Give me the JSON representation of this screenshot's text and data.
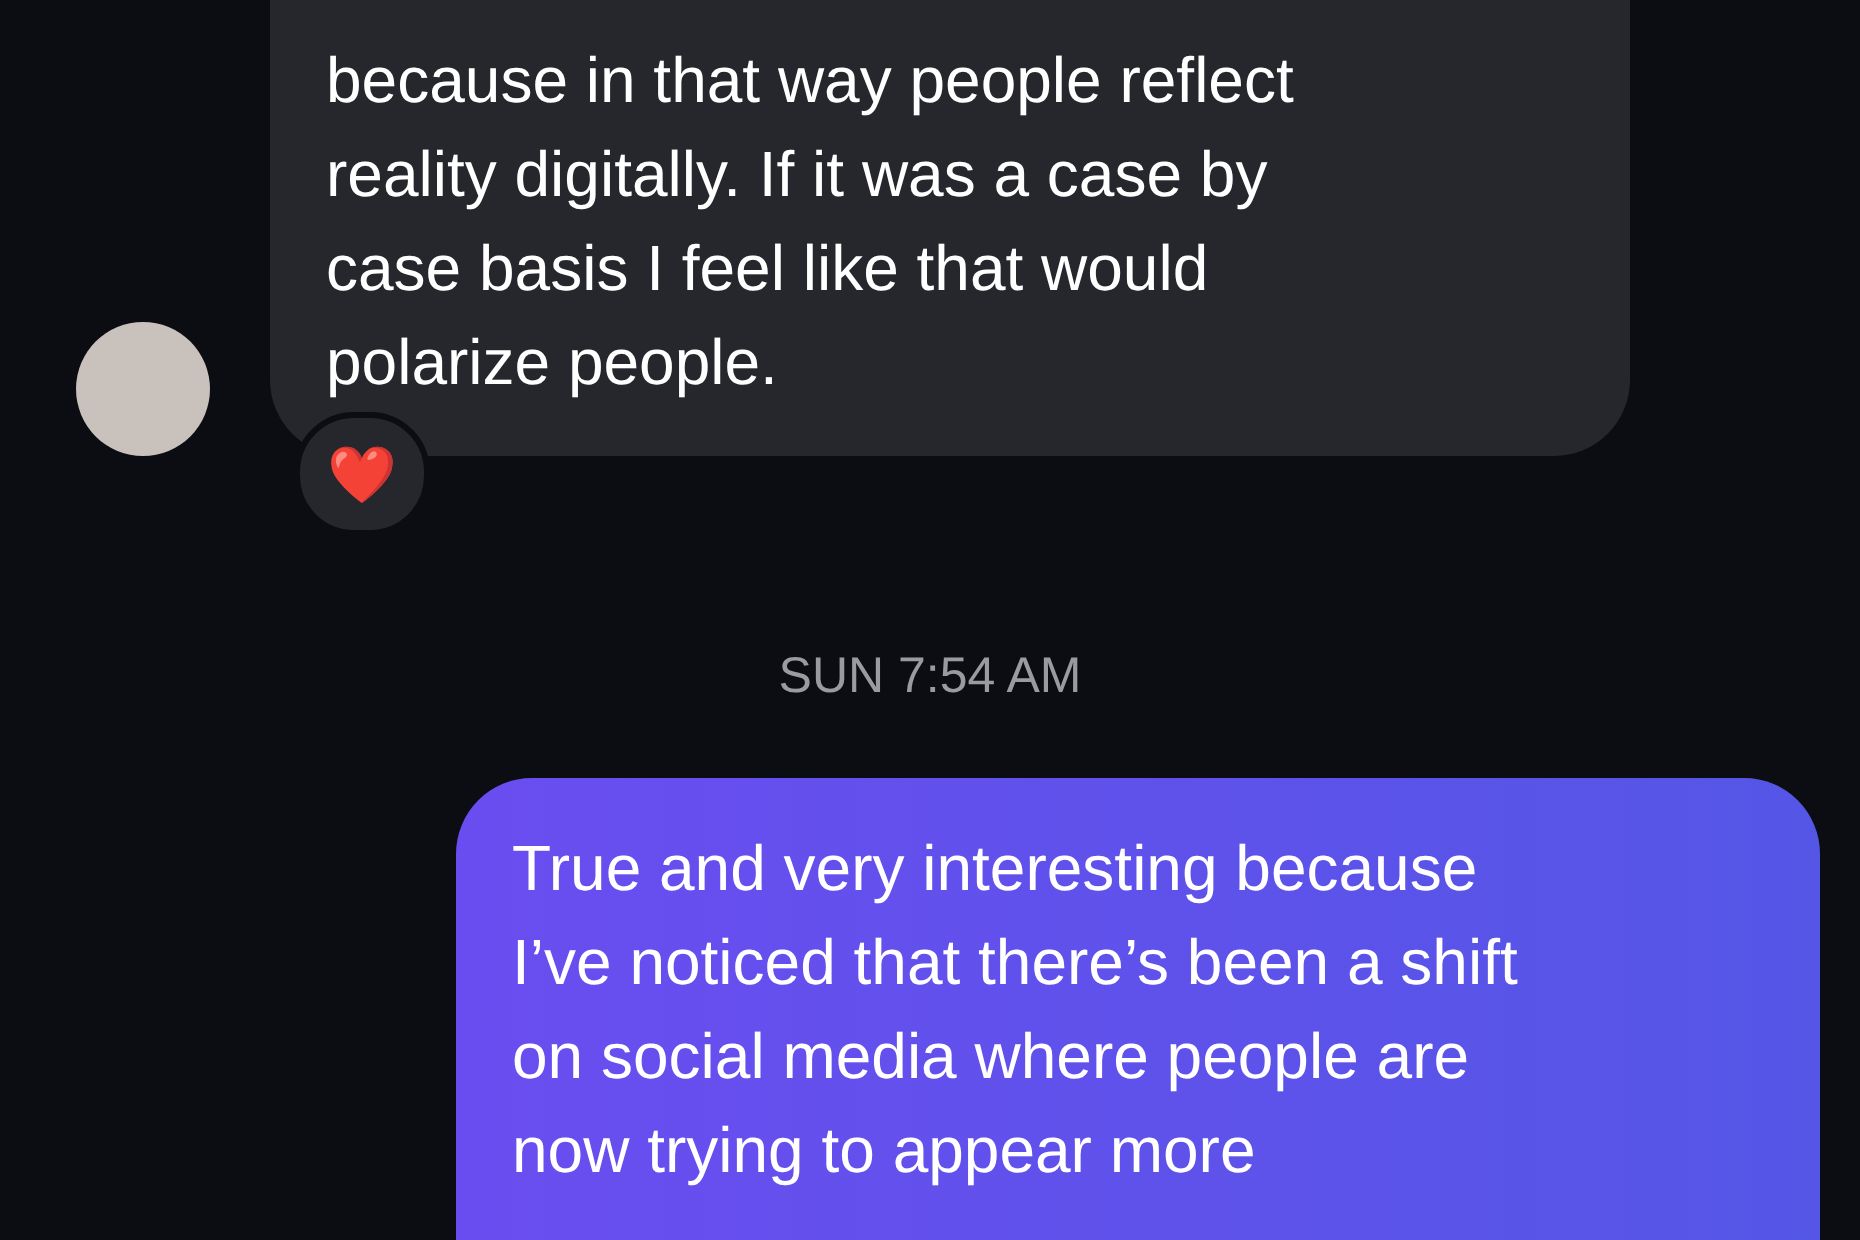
{
  "messages": [
    {
      "kind": "incoming",
      "text": "because in that way people reflect\nreality digitally. If it was a case by\ncase basis I feel like that would\npolarize people.",
      "reaction": "❤️"
    },
    {
      "kind": "timestamp",
      "text": "SUN 7:54 AM"
    },
    {
      "kind": "outgoing",
      "text": "True and very interesting because\nI’ve noticed that there’s been a shift\non social media where people are\nnow trying to appear more"
    }
  ]
}
